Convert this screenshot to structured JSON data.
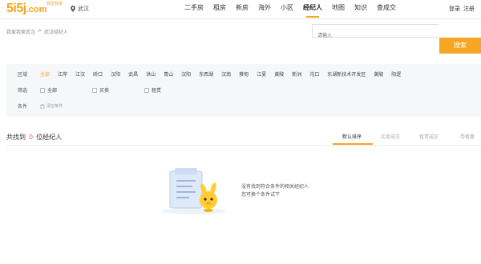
{
  "header": {
    "logo_main": "5i5j",
    "logo_domain": ".com",
    "logo_tagline": "我爱我家",
    "city": "武汉",
    "nav": [
      "二手房",
      "租房",
      "新房",
      "海外",
      "小区",
      "经纪人",
      "地图",
      "知识",
      "查成交"
    ],
    "active_nav": "经纪人",
    "login": "登录",
    "register": "注册"
  },
  "breadcrumb": [
    "我爱我家武汉",
    ">",
    "武汉经纪人"
  ],
  "search": {
    "placeholder": "请输入",
    "button": "搜索"
  },
  "filters": {
    "region_label": "区域",
    "regions": [
      "全部",
      "江岸",
      "江汉",
      "硚口",
      "汉阳",
      "武昌",
      "洪山",
      "青山",
      "汉阳",
      "东西湖",
      "汉南",
      "蔡甸",
      "江夏",
      "黄陂",
      "新洲",
      "沌口",
      "东湖新技术开发区",
      "黄陂",
      "阳逻"
    ],
    "selected_region": "全部",
    "filter_label": "筛选",
    "filter_options": [
      "全部",
      "买卖",
      "租赁"
    ],
    "condition_label": "条件",
    "clear_label": "清空条件"
  },
  "results": {
    "prefix": "共找到",
    "count": "0",
    "suffix": "位经纪人"
  },
  "sort": [
    "默认排序",
    "买卖成交",
    "租赁成交",
    "带看量"
  ],
  "active_sort": "默认排序",
  "empty": {
    "line1": "没有找到符合条件的相关经纪人",
    "line2": "您可换个条件试下"
  },
  "colors": {
    "accent": "#f5a623",
    "count": "#ff5555"
  }
}
